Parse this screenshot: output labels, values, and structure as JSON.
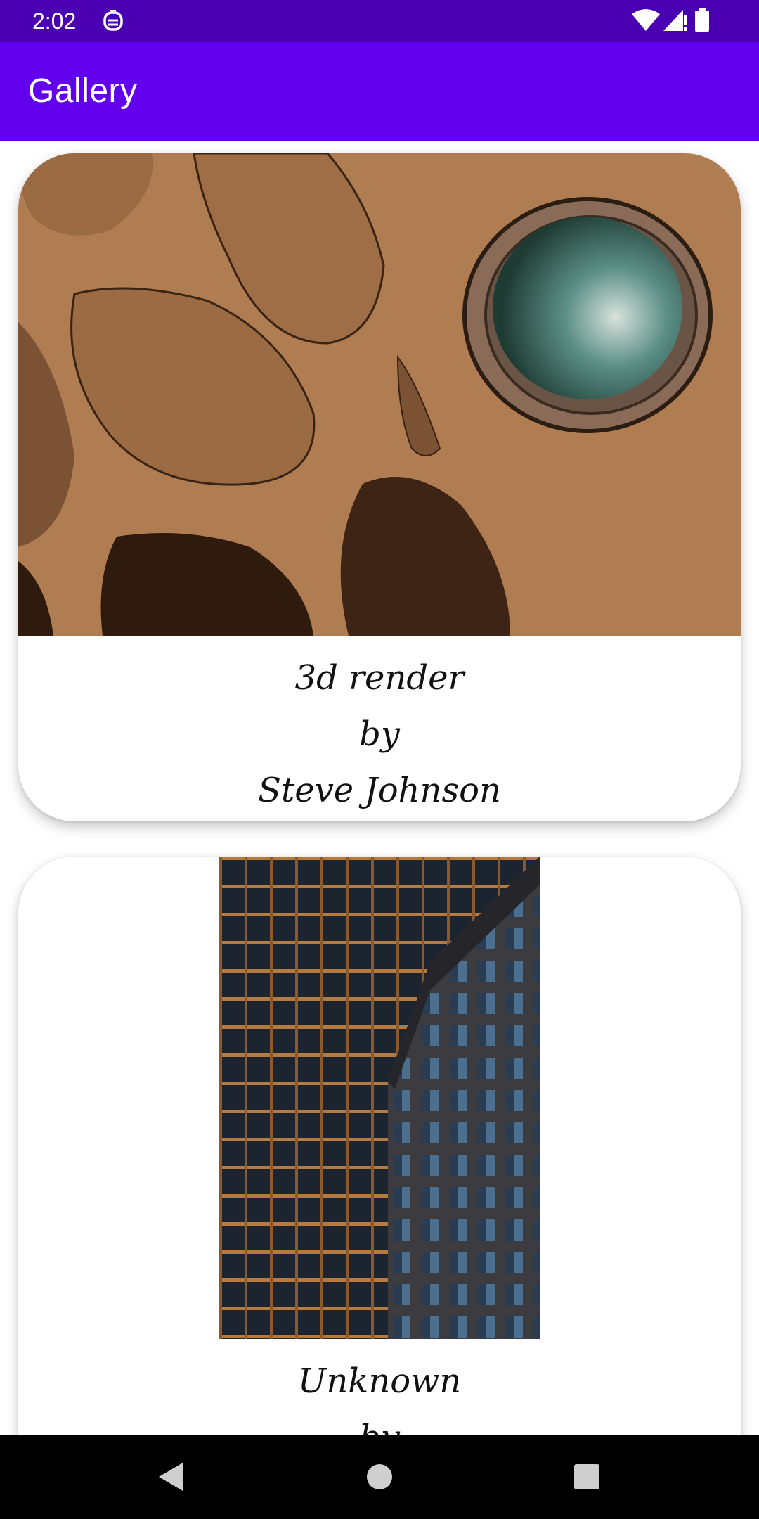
{
  "status_bar": {
    "time": "2:02",
    "icons": [
      "notification-icon",
      "wifi-icon",
      "signal-icon",
      "battery-icon"
    ]
  },
  "app_bar": {
    "title": "Gallery"
  },
  "cards": [
    {
      "image_icon": "abstract-3d-render-image",
      "title": "3d render",
      "by": "by",
      "author": "Steve Johnson"
    },
    {
      "image_icon": "building-facade-image",
      "title": "Unknown",
      "by": "by"
    }
  ],
  "nav_bar": {
    "buttons": [
      "back-icon",
      "home-icon",
      "recents-icon"
    ]
  },
  "colors": {
    "status_bar": "#4a00b2",
    "app_bar": "#6200ee",
    "nav_bar": "#000000",
    "card": "#ffffff"
  }
}
